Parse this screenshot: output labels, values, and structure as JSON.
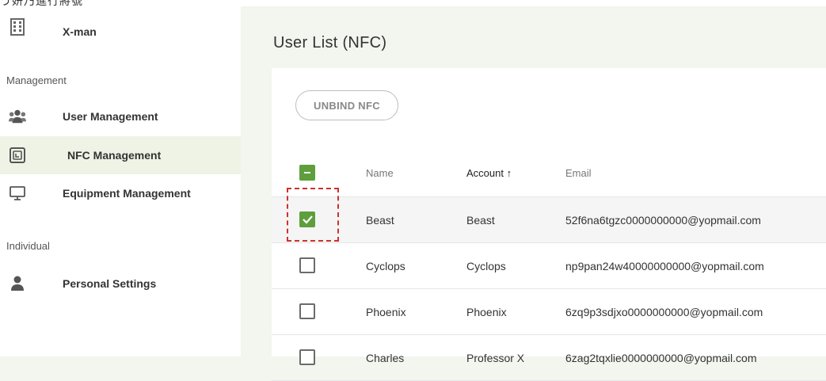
{
  "top_fragment": "う妍乃進行將號",
  "sidebar": {
    "org_name": "X-man",
    "sections": [
      {
        "title": "Management"
      },
      {
        "title": "Individual"
      }
    ],
    "items": [
      {
        "label": "User Management",
        "icon": "users-icon"
      },
      {
        "label": "NFC Management",
        "icon": "nfc-icon",
        "active": true
      },
      {
        "label": "Equipment Management",
        "icon": "monitor-icon"
      },
      {
        "label": "Personal Settings",
        "icon": "user-icon"
      }
    ]
  },
  "page": {
    "title": "User List (NFC)"
  },
  "toolbar": {
    "unbind_label": "UNBIND NFC"
  },
  "table": {
    "columns": [
      {
        "label": "Name"
      },
      {
        "label": "Account ↑"
      },
      {
        "label": "Email"
      }
    ],
    "rows": [
      {
        "name": "Beast",
        "account": "Beast",
        "email": "52f6na6tgzc0000000000@yopmail.com",
        "checked": true
      },
      {
        "name": "Cyclops",
        "account": "Cyclops",
        "email": "np9pan24w40000000000@yopmail.com",
        "checked": false
      },
      {
        "name": "Phoenix",
        "account": "Phoenix",
        "email": "6zq9p3sdjxo0000000000@yopmail.com",
        "checked": false
      },
      {
        "name": "Charles",
        "account": "Professor X",
        "email": "6zag2tqxlie0000000000@yopmail.com",
        "checked": false
      }
    ]
  },
  "colors": {
    "accent_green": "#5e9e3c",
    "highlight_dash": "#d0302a",
    "sidebar_active": "#eef3e6"
  }
}
